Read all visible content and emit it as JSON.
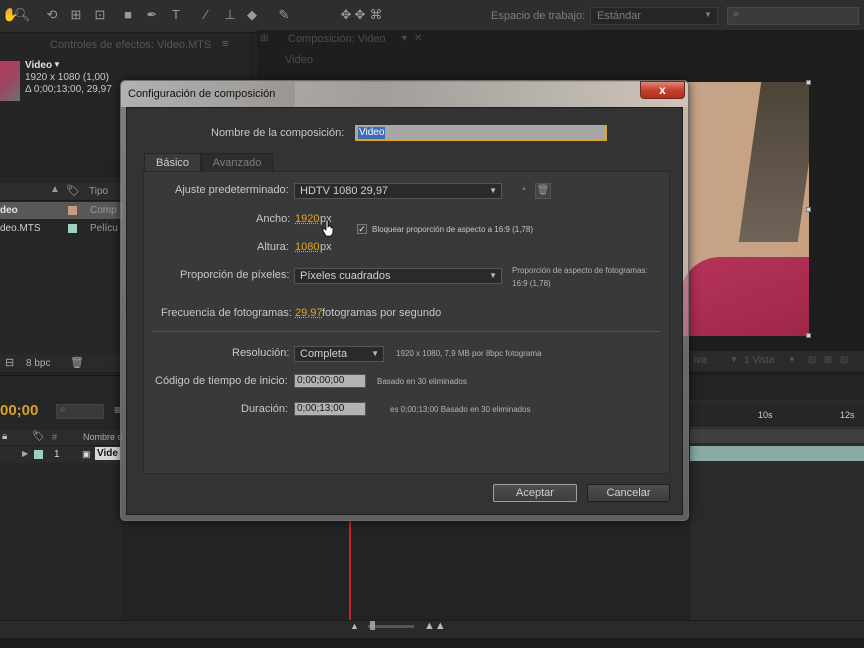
{
  "workspace": {
    "label": "Espacio de trabajo:",
    "value": "Estándar"
  },
  "panels": {
    "effects_tab": "Controles de efectos: Video.MTS",
    "composition_tab": "Composición: Video",
    "composition_sub": "Video"
  },
  "project": {
    "item_name": "Video",
    "resolution": "1920 x 1080 (1,00)",
    "duration": "Δ 0;00;13;00, 29,97",
    "header_type": "Tipo",
    "rows": [
      {
        "name": "deo",
        "type": "Comp"
      },
      {
        "name": "deo.MTS",
        "type": "Pelícu"
      }
    ],
    "bpc": "8 bpc"
  },
  "timeline": {
    "timecode": "00;00",
    "header_name": "Nombre c",
    "layer_index": "1",
    "layer_name": "Vide",
    "ruler": [
      "10s",
      "12s"
    ]
  },
  "comp_controls": {
    "view": "1 Vista",
    "render": "iva"
  },
  "dialog": {
    "title": "Configuración de composición",
    "close": "x",
    "name_label": "Nombre de la composición:",
    "name_value": "Video",
    "tabs": [
      "Básico",
      "Avanzado"
    ],
    "preset_label": "Ajuste predeterminado:",
    "preset_value": "HDTV 1080 29,97",
    "width_label": "Ancho:",
    "width_value": "1920",
    "width_unit": "px",
    "height_label": "Altura:",
    "height_value": "1080",
    "height_unit": "px",
    "lock_label": "Bloquear proporción de aspecto a 16:9 (1,78)",
    "lock_checked": true,
    "pixel_label": "Proporción de píxeles:",
    "pixel_value": "Píxeles cuadrados",
    "frame_aspect_label": "Proporción de aspecto de fotogramas:",
    "frame_aspect_value": "16:9 (1,78)",
    "fps_label": "Frecuencia de fotogramas:",
    "fps_value": "29,97",
    "fps_unit": "fotogramas por segundo",
    "resolution_label": "Resolución:",
    "resolution_value": "Completa",
    "resolution_info": "1920 x 1080, 7,9 MB por 8bpc fotograma",
    "start_label": "Código de tiempo de inicio:",
    "start_value": "0;00;00;00",
    "start_info": "Basado en 30 eliminados",
    "duration_label": "Duración:",
    "duration_value": "0;00;13;00",
    "duration_info": "es 0;00;13;00  Basado en 30 eliminados",
    "ok": "Aceptar",
    "cancel": "Cancelar"
  },
  "colors": {
    "accent_orange": "#e3a42a",
    "selection_blue": "#3d6eb5",
    "playhead_red": "#c6222a",
    "close_red": "#c5412c"
  }
}
